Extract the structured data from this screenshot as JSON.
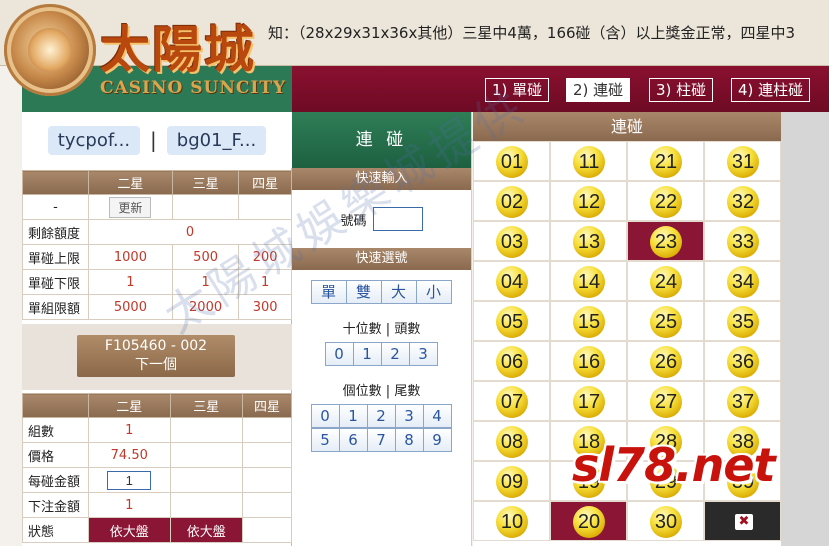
{
  "marquee": {
    "text": "知：（28x29x31x36x其他）三星中4萬，166碰（含）以上獎金正常，四星中3"
  },
  "logo": {
    "chinese": "太陽城",
    "english": "CASINO SUNCITY"
  },
  "account": {
    "user": "tycpof...",
    "separator": "|",
    "game": "bg01_F..."
  },
  "limits": {
    "headers": [
      "二星",
      "三星",
      "四星"
    ],
    "refresh_row_label": "-",
    "refresh_label": "更新",
    "rows": [
      {
        "label": "剩餘額度",
        "value": "0"
      },
      {
        "label": "單碰上限",
        "values": [
          "1000",
          "500",
          "200"
        ]
      },
      {
        "label": "單碰下限",
        "values": [
          "1",
          "1",
          "1"
        ]
      },
      {
        "label": "單組限額",
        "values": [
          "5000",
          "2000",
          "300"
        ]
      }
    ]
  },
  "next": {
    "code": "F105460 - 002",
    "label": "下一個"
  },
  "bet": {
    "headers": [
      "二星",
      "三星",
      "四星"
    ],
    "rows": [
      {
        "label": "組數",
        "value": "1"
      },
      {
        "label": "價格",
        "value": "74.50"
      },
      {
        "label": "每碰金額",
        "value": "1"
      },
      {
        "label": "下注金額",
        "value": "1"
      },
      {
        "label": "狀態",
        "values": [
          "依大盤",
          "依大盤"
        ]
      }
    ]
  },
  "modes": [
    "1) 單碰",
    "2) 連碰",
    "3) 柱碰",
    "4) 連柱碰"
  ],
  "active_mode": 1,
  "middle": {
    "title": "連 碰",
    "quick_input": "快速輸入",
    "number_label": "號碼",
    "quick_select": "快速選號",
    "filters": [
      "單",
      "雙",
      "大",
      "小"
    ],
    "tens_label": "十位數 | 頭數",
    "tens": [
      "0",
      "1",
      "2",
      "3"
    ],
    "units_label": "個位數 | 尾數",
    "units": [
      "0",
      "1",
      "2",
      "3",
      "4",
      "5",
      "6",
      "7",
      "8",
      "9"
    ]
  },
  "balls": {
    "title": "連碰",
    "numbers": [
      "01",
      "02",
      "03",
      "04",
      "05",
      "06",
      "07",
      "08",
      "09",
      "10",
      "11",
      "12",
      "13",
      "14",
      "15",
      "16",
      "17",
      "18",
      "19",
      "20",
      "21",
      "22",
      "23",
      "24",
      "25",
      "26",
      "27",
      "28",
      "29",
      "30",
      "31",
      "32",
      "33",
      "34",
      "35",
      "36",
      "37",
      "38",
      "39"
    ],
    "selected": [
      "20",
      "23"
    ]
  },
  "watermark": "太陽城娛樂城提供",
  "site_watermark": "sl78.net"
}
